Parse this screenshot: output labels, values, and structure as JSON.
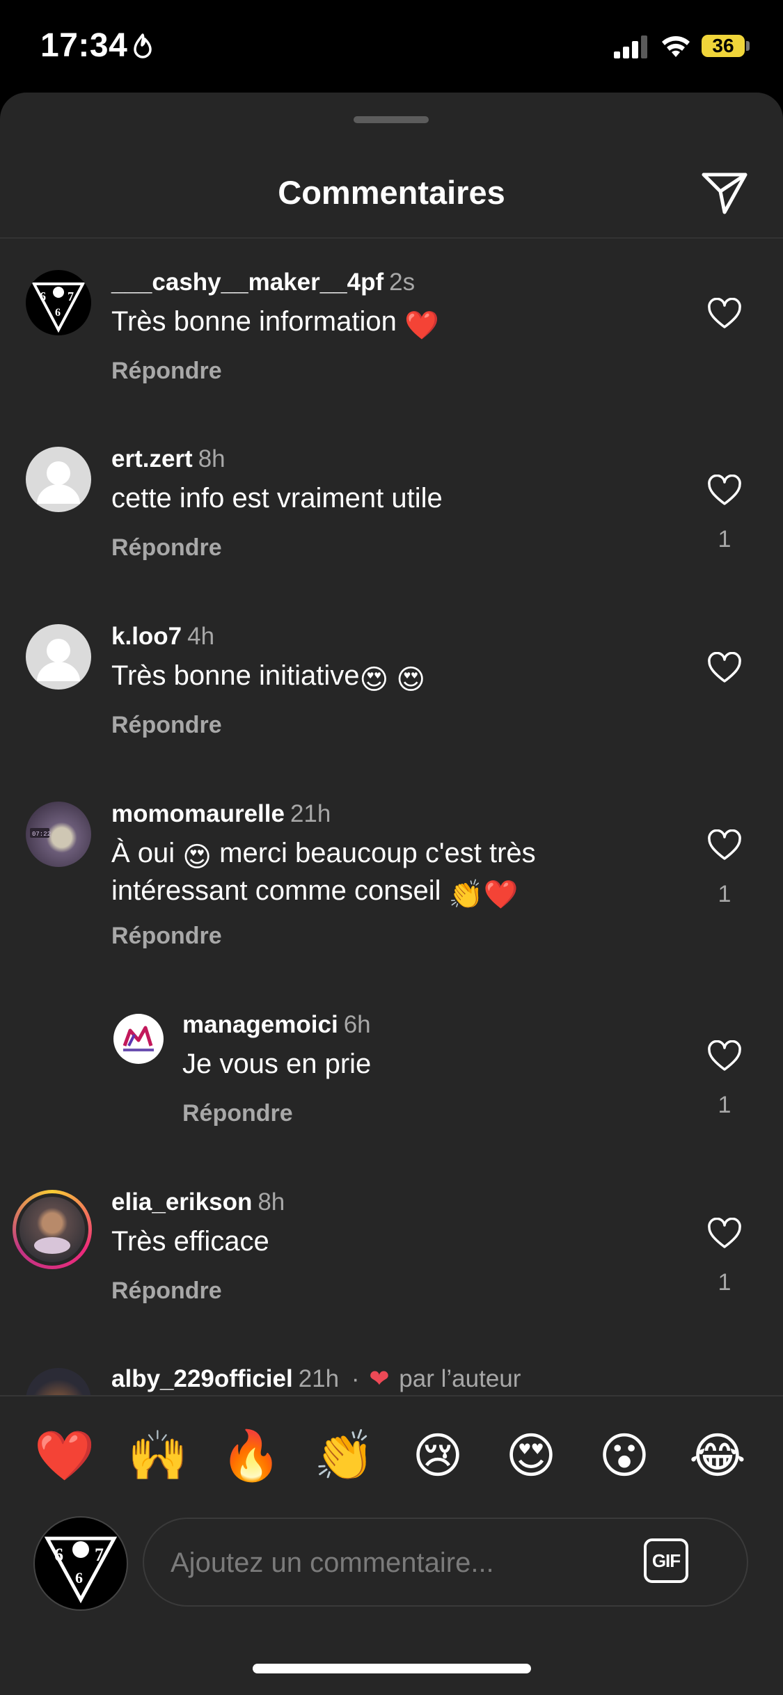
{
  "status_bar": {
    "time": "17:34",
    "battery": "36"
  },
  "sheet": {
    "title": "Commentaires"
  },
  "comments": [
    {
      "username": "___cashy__maker__4pf",
      "ago": "2s",
      "text": "Très bonne information",
      "reply": "Répondre"
    },
    {
      "username": "ert.zert",
      "ago": "8h",
      "text": "cette info est vraiment utile",
      "reply": "Répondre",
      "likes": "1"
    },
    {
      "username": "k.loo7",
      "ago": "4h",
      "text": "Très bonne initiative",
      "reply": "Répondre"
    },
    {
      "username": "momomaurelle",
      "ago": "21h",
      "text_line1": "À oui",
      "text_line1b": "merci beaucoup c'est très",
      "text_line2": "intéressant comme conseil",
      "reply": "Répondre",
      "likes": "1"
    },
    {
      "username": "managemoici",
      "ago": "6h",
      "text": "Je vous en prie",
      "reply": "Répondre",
      "likes": "1"
    },
    {
      "username": "elia_erikson",
      "ago": "8h",
      "text": "Très efficace",
      "reply": "Répondre",
      "likes": "1"
    },
    {
      "username": "alby_229officiel",
      "ago": "21h",
      "separator": "·",
      "author_like": "par l’auteur"
    }
  ],
  "emoji_bar": [
    "❤️",
    "🙌",
    "🔥",
    "👏",
    "😢",
    "😍",
    "😮",
    "😂"
  ],
  "composer": {
    "placeholder": "Ajoutez un commentaire...",
    "gif_label": "GIF"
  }
}
